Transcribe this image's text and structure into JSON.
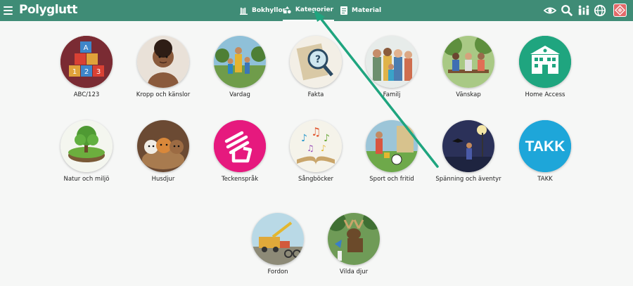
{
  "header": {
    "logo": "Polyglutt",
    "nav": [
      {
        "label": "Bokhyllor",
        "icon": "bookshelf-icon"
      },
      {
        "label": "Kategorier",
        "icon": "categories-icon",
        "active": true
      },
      {
        "label": "Material",
        "icon": "material-icon"
      }
    ],
    "right_icons": [
      "eye-icon",
      "search-icon",
      "family-icon",
      "globe-icon",
      "user-avatar"
    ]
  },
  "categories": [
    {
      "label": "ABC/123"
    },
    {
      "label": "Kropp och känslor"
    },
    {
      "label": "Vardag"
    },
    {
      "label": "Fakta"
    },
    {
      "label": "Familj"
    },
    {
      "label": "Vänskap"
    },
    {
      "label": "Home Access"
    },
    {
      "label": "Natur och miljö"
    },
    {
      "label": "Husdjur"
    },
    {
      "label": "Teckenspråk"
    },
    {
      "label": "Sångböcker"
    },
    {
      "label": "Sport och fritid"
    },
    {
      "label": "Spänning och äventyr"
    },
    {
      "label": "TAKK",
      "badge": "TAKK"
    },
    {
      "label": "Fordon"
    },
    {
      "label": "Vilda djur"
    }
  ],
  "colors": {
    "header": "#3f8c76",
    "accent": "#1fa57f",
    "pink": "#e6197e",
    "takk": "#1ea6d9"
  }
}
